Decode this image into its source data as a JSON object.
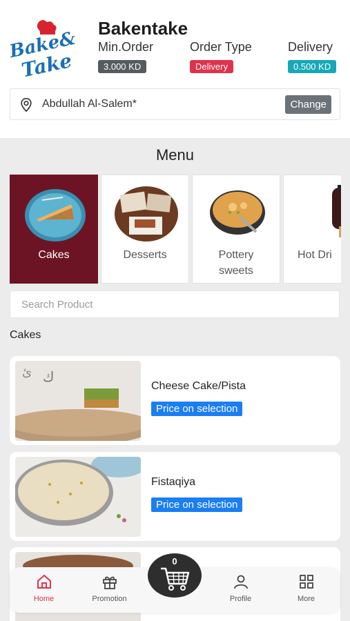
{
  "shop": {
    "name": "Bakentake",
    "logo_text_line1": "Bake&",
    "logo_text_line2": "Take",
    "min_order_label": "Min.Order",
    "min_order_value": "3.000 KD",
    "order_type_label": "Order Type",
    "order_type_value": "Delivery",
    "delivery_label": "Delivery",
    "delivery_value": "0.500 KD"
  },
  "address": {
    "text": "Abdullah Al-Salem*",
    "change_label": "Change",
    "icon": "location-pin-icon"
  },
  "menu": {
    "title": "Menu",
    "categories": [
      {
        "label": "Cakes",
        "active": true
      },
      {
        "label": "Desserts",
        "active": false
      },
      {
        "label": "Pottery sweets",
        "active": false
      },
      {
        "label": "Hot Dri",
        "active": false
      }
    ]
  },
  "search": {
    "placeholder": "Search Product"
  },
  "section": {
    "title": "Cakes"
  },
  "products": [
    {
      "name": "Cheese Cake/Pista",
      "price_label": "Price on selection"
    },
    {
      "name": "Fistaqiya",
      "price_label": "Price on selection"
    },
    {
      "name": "",
      "price_label": ""
    }
  ],
  "cart": {
    "count": "0",
    "icon": "cart-icon"
  },
  "nav": [
    {
      "label": "Home",
      "icon": "home-icon",
      "active": true
    },
    {
      "label": "Promotion",
      "icon": "gift-icon",
      "active": false
    },
    {
      "label": "Profile",
      "icon": "user-icon",
      "active": false
    },
    {
      "label": "More",
      "icon": "grid-icon",
      "active": false
    }
  ],
  "colors": {
    "brand_maroon": "#6d1424",
    "accent_red": "#e0324b",
    "teal": "#17a8b8",
    "price_blue": "#1a7ef5",
    "menu_bg": "#ececec"
  }
}
